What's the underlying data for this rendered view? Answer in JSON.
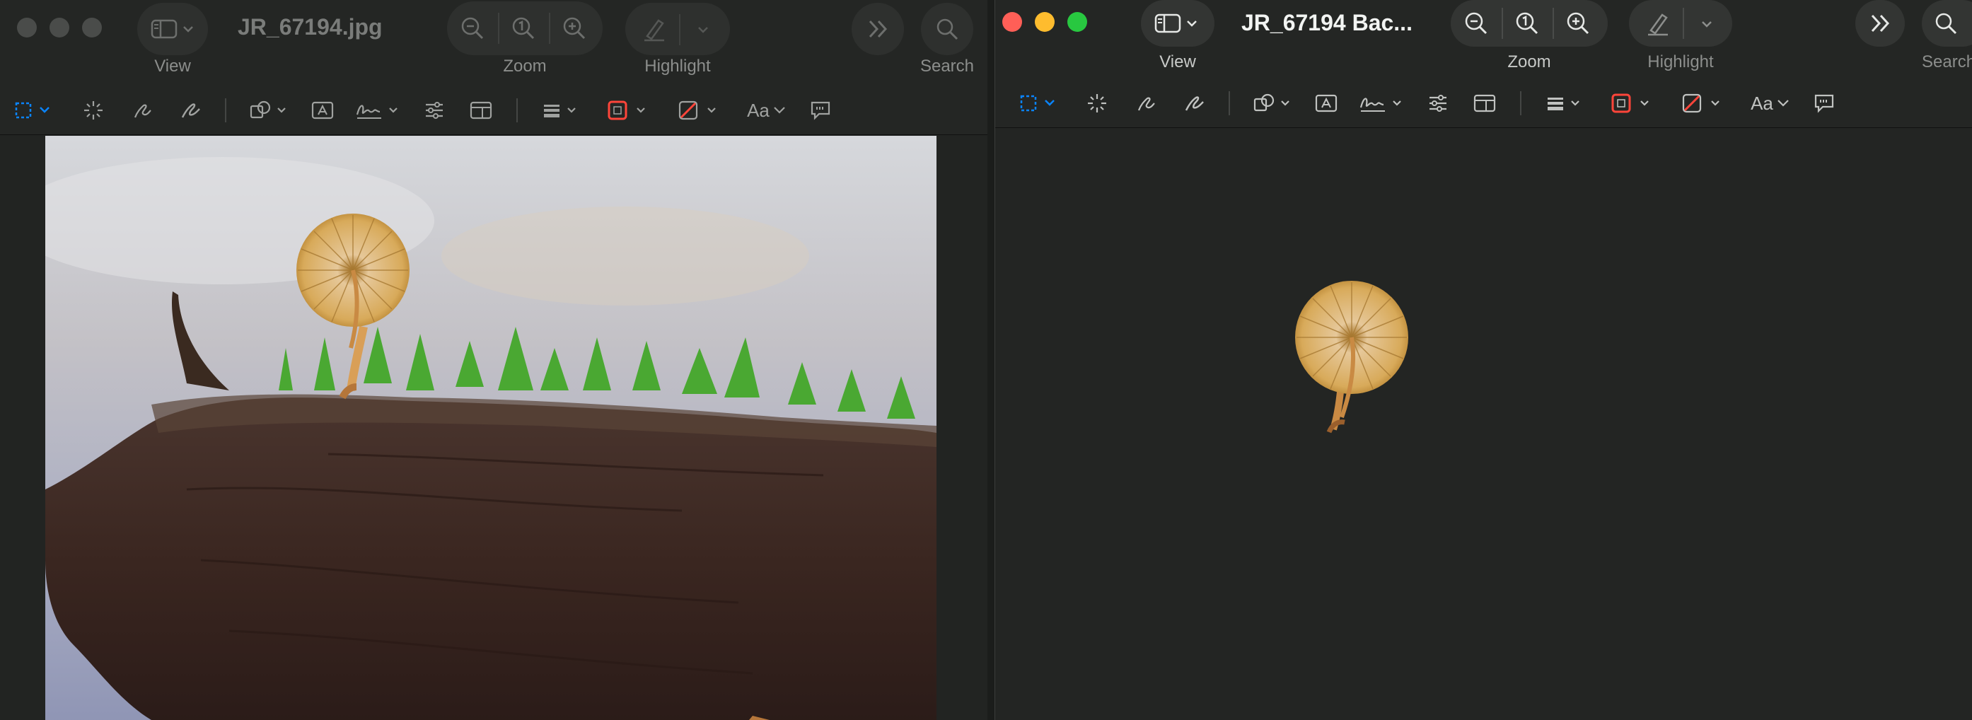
{
  "left_window": {
    "title": "JR_67194.jpg",
    "labels": {
      "view": "View",
      "zoom": "Zoom",
      "highlight": "Highlight",
      "search": "Search"
    },
    "font_button": "Aa",
    "image": "mushroom-photo"
  },
  "right_window": {
    "title": "JR_67194 Bac...",
    "labels": {
      "view": "View",
      "zoom": "Zoom",
      "highlight": "Highlight",
      "search": "Search"
    },
    "font_button": "Aa",
    "image": "mushroom-cutout"
  },
  "colors": {
    "close": "#ff5f57",
    "minimize": "#febc2e",
    "zoom": "#28c840",
    "accent": "#0a84ff",
    "border_color": "#ff453a"
  }
}
